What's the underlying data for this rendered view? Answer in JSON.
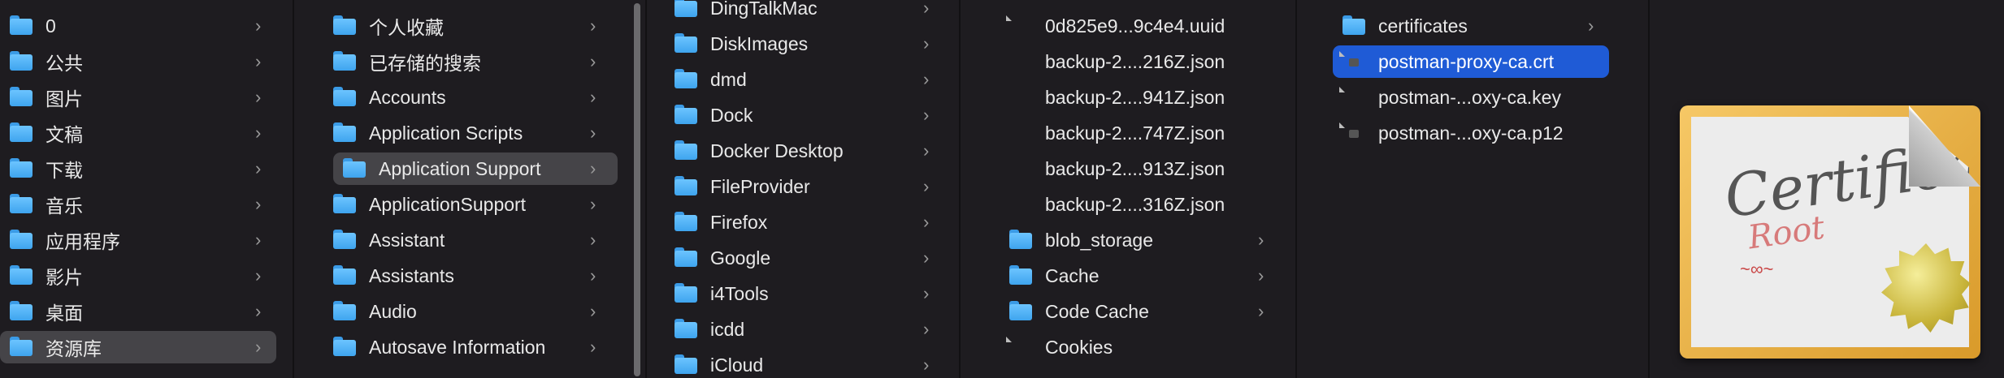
{
  "column1": {
    "items": [
      {
        "label": "0",
        "icon": "folder-icon"
      },
      {
        "label": "公共",
        "icon": "public-folder-icon"
      },
      {
        "label": "图片",
        "icon": "pictures-folder-icon"
      },
      {
        "label": "文稿",
        "icon": "documents-folder-icon"
      },
      {
        "label": "下载",
        "icon": "downloads-folder-icon"
      },
      {
        "label": "音乐",
        "icon": "music-folder-icon"
      },
      {
        "label": "应用程序",
        "icon": "applications-folder-icon"
      },
      {
        "label": "影片",
        "icon": "movies-folder-icon"
      },
      {
        "label": "桌面",
        "icon": "desktop-folder-icon"
      },
      {
        "label": "资源库",
        "icon": "library-folder-icon",
        "selected": true
      }
    ]
  },
  "column2": {
    "items": [
      {
        "label": "个人收藏"
      },
      {
        "label": "已存储的搜索"
      },
      {
        "label": "Accounts"
      },
      {
        "label": "Application Scripts"
      },
      {
        "label": "Application Support",
        "selected": true
      },
      {
        "label": "ApplicationSupport",
        "alias": true
      },
      {
        "label": "Assistant"
      },
      {
        "label": "Assistants"
      },
      {
        "label": "Audio"
      },
      {
        "label": "Autosave Information"
      }
    ]
  },
  "column3": {
    "items": [
      {
        "label": "DingTalkMac"
      },
      {
        "label": "DiskImages"
      },
      {
        "label": "dmd"
      },
      {
        "label": "Dock"
      },
      {
        "label": "Docker Desktop"
      },
      {
        "label": "FileProvider"
      },
      {
        "label": "Firefox"
      },
      {
        "label": "Google"
      },
      {
        "label": "i4Tools"
      },
      {
        "label": "icdd"
      },
      {
        "label": "iCloud"
      }
    ]
  },
  "column4": {
    "items": [
      {
        "label": "0d825e9...9c4e4.uuid",
        "type": "file"
      },
      {
        "label": "backup-2....216Z.json",
        "type": "none"
      },
      {
        "label": "backup-2....941Z.json",
        "type": "none"
      },
      {
        "label": "backup-2....747Z.json",
        "type": "none"
      },
      {
        "label": "backup-2....913Z.json",
        "type": "none"
      },
      {
        "label": "backup-2....316Z.json",
        "type": "none"
      },
      {
        "label": "blob_storage",
        "type": "folder"
      },
      {
        "label": "Cache",
        "type": "folder"
      },
      {
        "label": "Code Cache",
        "type": "folder"
      },
      {
        "label": "Cookies",
        "type": "file"
      }
    ]
  },
  "column5": {
    "items": [
      {
        "label": "certificates",
        "type": "folder"
      },
      {
        "label": "postman-proxy-ca.crt",
        "type": "cert",
        "selected": true
      },
      {
        "label": "postman-...oxy-ca.key",
        "type": "file"
      },
      {
        "label": "postman-...oxy-ca.p12",
        "type": "cert"
      }
    ]
  },
  "preview": {
    "title": "Certificate",
    "subtitle": "Root",
    "icon": "certificate-icon"
  },
  "colors": {
    "selection_blue": "#1f5bd6",
    "selection_gray": "#454448",
    "folder_blue": "#4fb0f5",
    "background": "#1e1c20"
  }
}
